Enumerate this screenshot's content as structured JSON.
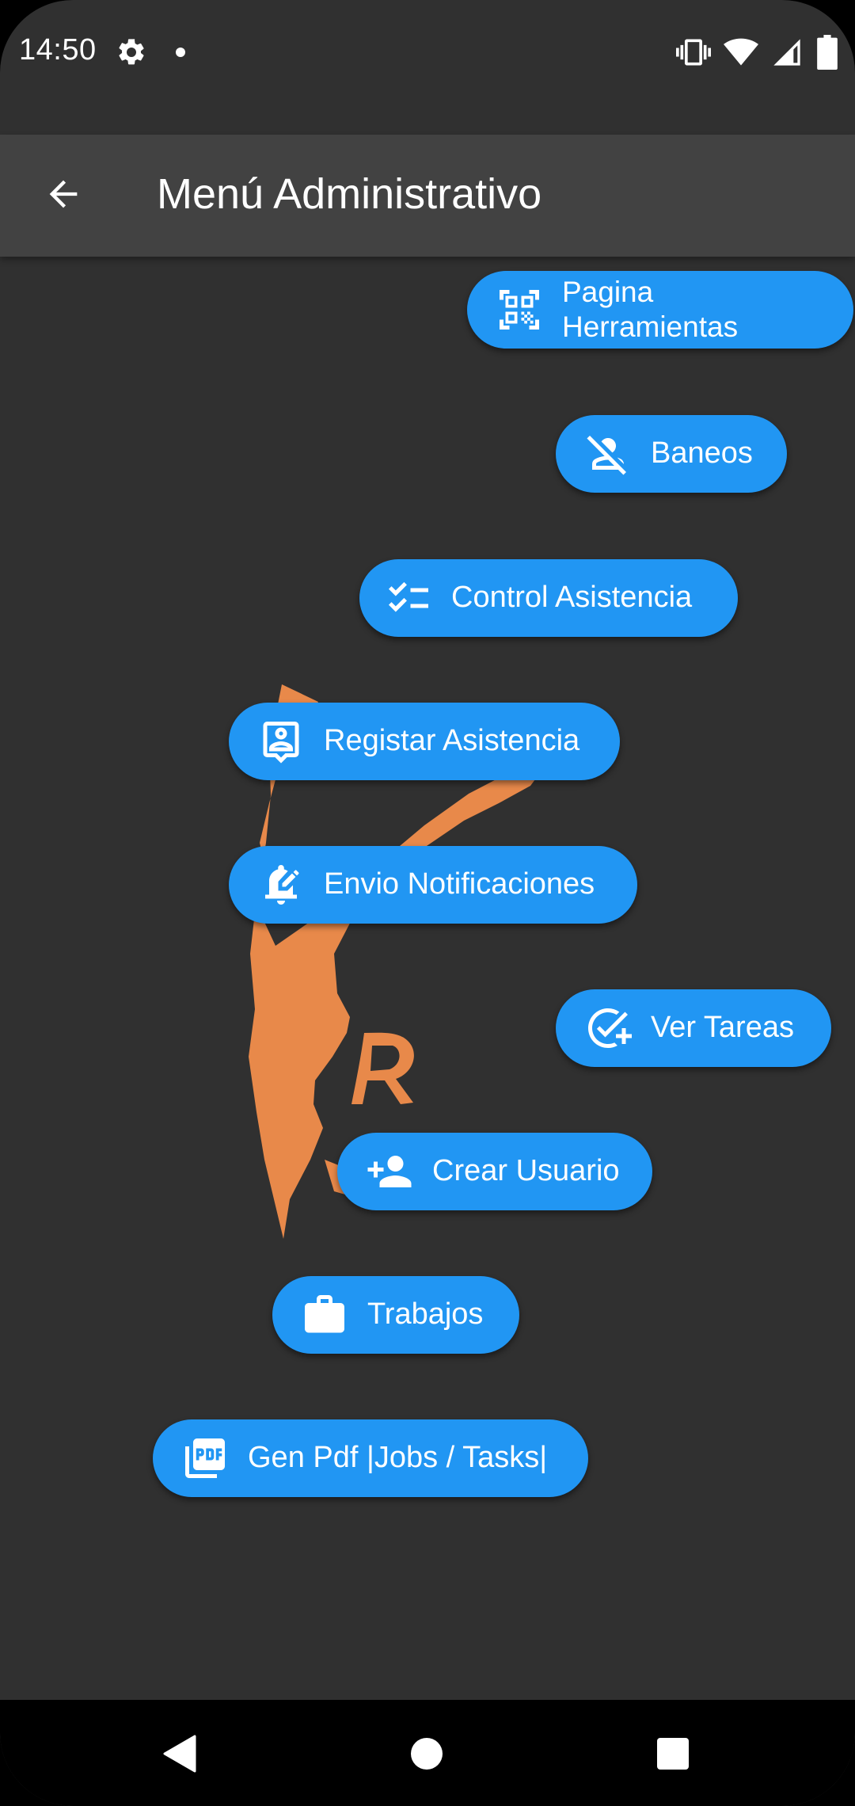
{
  "status_bar": {
    "time": "14:50",
    "icons": [
      "settings-icon",
      "notification-dot-icon",
      "vibrate-icon",
      "wifi-icon",
      "signal-icon",
      "battery-icon"
    ]
  },
  "app_bar": {
    "title": "Menú Administrativo",
    "back_icon": "arrow-back-icon"
  },
  "buttons": [
    {
      "label": "Pagina Herramientas",
      "icon": "qr-code-scanner-icon"
    },
    {
      "label": "Baneos",
      "icon": "person-off-icon"
    },
    {
      "label": "Control Asistencia",
      "icon": "checklist-icon"
    },
    {
      "label": "Registar Asistencia",
      "icon": "contact-badge-icon"
    },
    {
      "label": "Envio Notificaciones",
      "icon": "edit-notifications-icon"
    },
    {
      "label": "Ver Tareas",
      "icon": "add-task-icon"
    },
    {
      "label": "Crear Usuario",
      "icon": "person-add-icon"
    },
    {
      "label": "Trabajos",
      "icon": "work-icon"
    },
    {
      "label": "Gen Pdf |Jobs / Tasks|",
      "icon": "picture-as-pdf-icon"
    }
  ],
  "colors": {
    "background": "#303030",
    "app_bar": "#424242",
    "button": "#2196F3",
    "logo": "#E8894A"
  },
  "nav_bar": {
    "icons": [
      "nav-back-icon",
      "nav-home-icon",
      "nav-recents-icon"
    ]
  }
}
